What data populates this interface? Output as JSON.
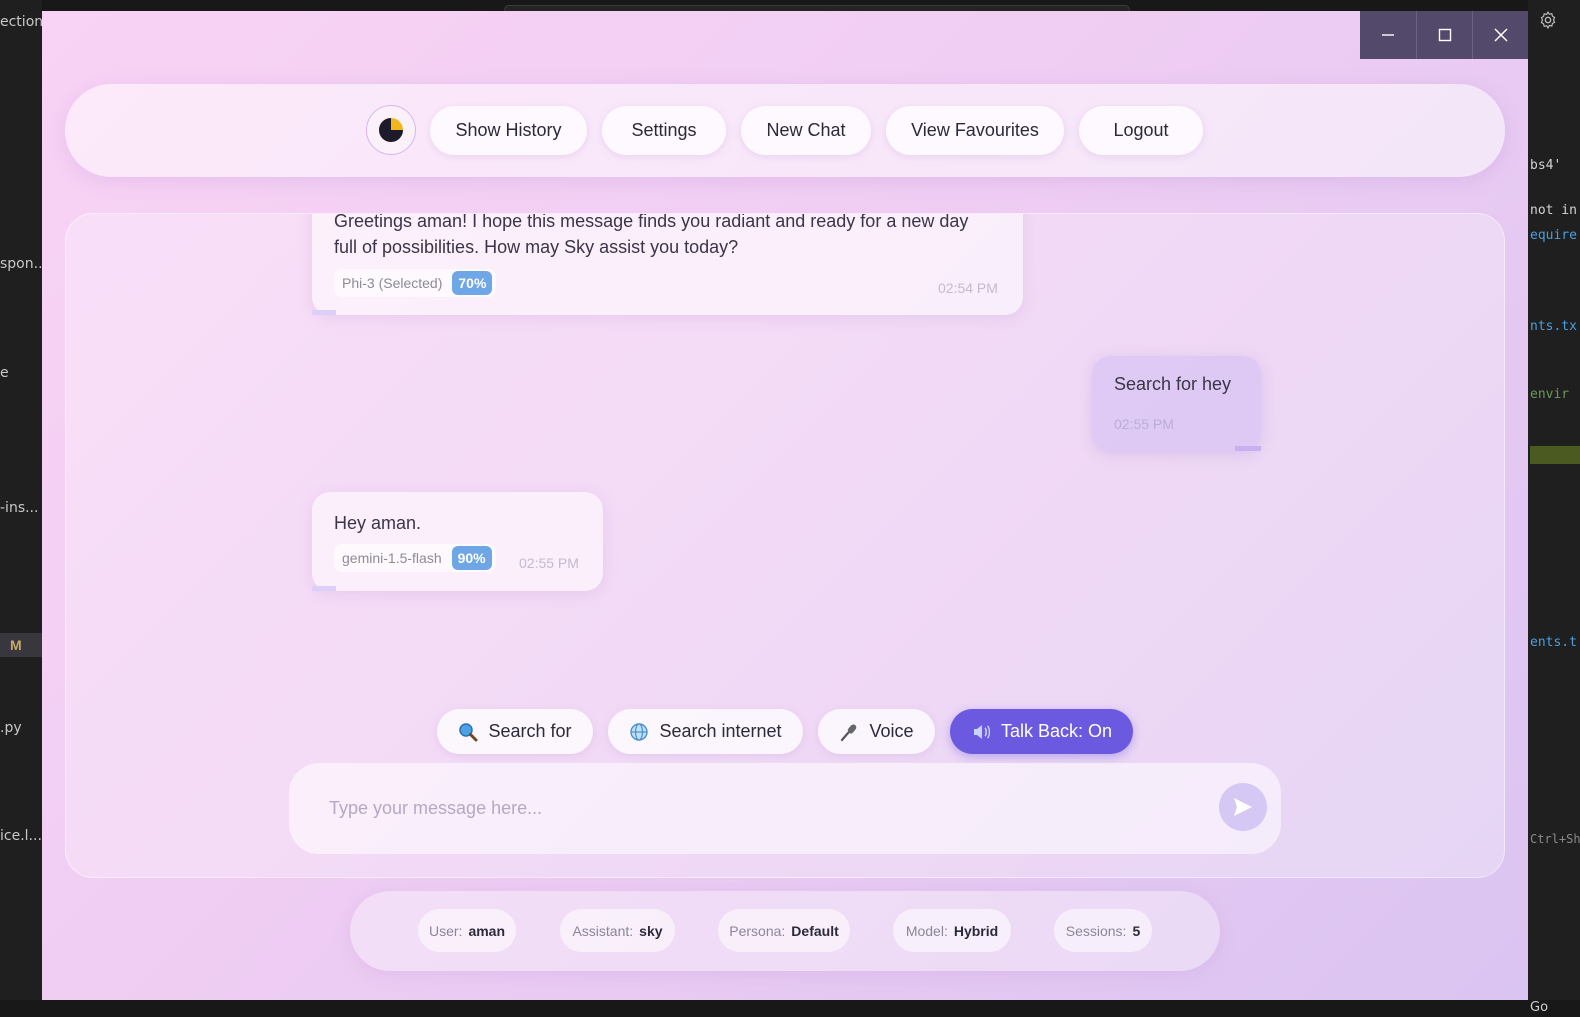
{
  "background_editor": {
    "left_fragments": [
      "ection",
      "spon...",
      "e",
      "-ins...",
      "M",
      ".py",
      "ice.l..."
    ],
    "right_fragments": [
      "bs4'",
      "not in",
      "equire",
      "nts.tx",
      "envir",
      "ents.t",
      "Ctrl+Shi"
    ],
    "status_go": "Go"
  },
  "window_controls": {
    "minimize": "minimize",
    "maximize": "maximize",
    "close": "close"
  },
  "nav": {
    "theme_icon": "moon-icon",
    "show_history": "Show History",
    "settings": "Settings",
    "new_chat": "New Chat",
    "view_favourites": "View Favourites",
    "logout": "Logout"
  },
  "messages": [
    {
      "role": "assistant",
      "text_line1": "Greetings aman! I hope this message finds you radiant and ready for a new day",
      "text_line2": "full of possibilities. How may Sky assist you today?",
      "model": "Phi-3 (Selected)",
      "confidence": "70%",
      "time": "02:54 PM"
    },
    {
      "role": "user",
      "text": "Search for hey",
      "time": "02:55 PM"
    },
    {
      "role": "assistant",
      "text": "Hey aman.",
      "model": "gemini-1.5-flash",
      "confidence": "90%",
      "time": "02:55 PM"
    }
  ],
  "actions": {
    "search_for": "Search for",
    "search_internet": "Search internet",
    "voice": "Voice",
    "talk_back": "Talk Back: On"
  },
  "composer": {
    "placeholder": "Type your message here...",
    "value": ""
  },
  "info": {
    "user_label": "User:",
    "user_value": "aman",
    "assistant_label": "Assistant:",
    "assistant_value": "sky",
    "persona_label": "Persona:",
    "persona_value": "Default",
    "model_label": "Model:",
    "model_value": "Hybrid",
    "sessions_label": "Sessions:",
    "sessions_value": "5"
  },
  "colors": {
    "accent": "#6b5ae0",
    "confidence_badge": "#6fa6e6",
    "window_controls": "#534a6b"
  }
}
